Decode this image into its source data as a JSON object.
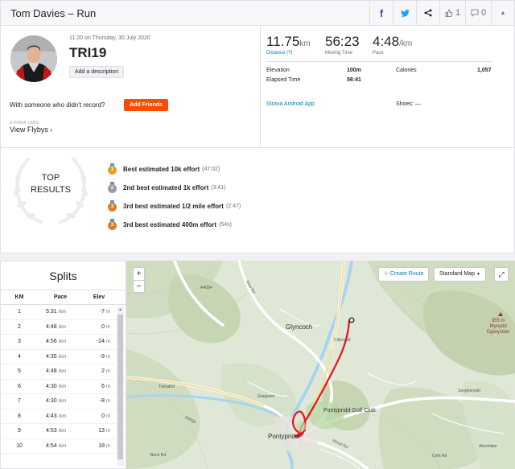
{
  "header": {
    "title": "Tom Davies – Run",
    "kudos_count": "1",
    "comment_count": "0"
  },
  "summary": {
    "datetime": "11:20 on Thursday, 30 July 2020",
    "title": "TRI19",
    "add_description": "Add a description",
    "with_someone": "With someone who didn't record?",
    "add_friends": "Add Friends",
    "labs_label": "STRAVA LABS",
    "view_flybys": "View Flybys",
    "stats": [
      {
        "value": "11.75",
        "unit": "km",
        "label": "Distance (?)"
      },
      {
        "value": "56:23",
        "unit": "",
        "label": "Moving Time"
      },
      {
        "value": "4:48",
        "unit": "/km",
        "label": "Pace"
      }
    ],
    "elevation_label": "Elevation",
    "elevation_value": "100m",
    "elapsed_label": "Elapsed Time",
    "elapsed_value": "56:41",
    "calories_label": "Calories",
    "calories_value": "1,057",
    "device": "Strava Android App",
    "shoes": "Shoes: —"
  },
  "top_results": {
    "label_line1": "TOP",
    "label_line2": "RESULTS",
    "items": [
      {
        "rank": "1",
        "text": "Best estimated 10k effort",
        "time": "(47:02)",
        "color": "#e0a030"
      },
      {
        "rank": "2",
        "text": "2nd best estimated 1k effort",
        "time": "(3:41)",
        "color": "#9a9aa0"
      },
      {
        "rank": "3",
        "text": "3rd best estimated 1/2 mile effort",
        "time": "(2:47)",
        "color": "#d8802a"
      },
      {
        "rank": "3",
        "text": "3rd best estimated 400m effort",
        "time": "(54s)",
        "color": "#d8802a"
      }
    ]
  },
  "splits": {
    "title": "Splits",
    "headers": {
      "km": "KM",
      "pace": "Pace",
      "elev": "Elev"
    },
    "pace_unit": "/km",
    "elev_unit": "m",
    "rows": [
      {
        "km": "1",
        "pace": "5:31",
        "elev": "-7"
      },
      {
        "km": "2",
        "pace": "4:48",
        "elev": "0"
      },
      {
        "km": "3",
        "pace": "4:56",
        "elev": "-24"
      },
      {
        "km": "4",
        "pace": "4:35",
        "elev": "-9"
      },
      {
        "km": "5",
        "pace": "4:48",
        "elev": "2"
      },
      {
        "km": "6",
        "pace": "4:30",
        "elev": "6"
      },
      {
        "km": "7",
        "pace": "4:30",
        "elev": "-8"
      },
      {
        "km": "8",
        "pace": "4:43",
        "elev": "0"
      },
      {
        "km": "9",
        "pace": "4:53",
        "elev": "13"
      },
      {
        "km": "10",
        "pace": "4:54",
        "elev": "18"
      }
    ]
  },
  "map": {
    "zoom_in": "+",
    "zoom_out": "−",
    "create_route": "Create Route",
    "map_type": "Standard Map",
    "places": {
      "glyncoch": "Glyncoch",
      "cilfynydd": "Cilfynydd",
      "trehafod": "Trehafod",
      "graigwen": "Graigwen",
      "golf_club": "Pontypridd Golf Club",
      "pontypridd": "Pontypridd",
      "berw_road": "Berw Rd",
      "new_rd": "New Rd",
      "a4058": "A4058",
      "a4054": "A4054",
      "wood_rd": "Wood Rd",
      "cefn": "Cefn Rd",
      "abertridwr": "Abertridwr",
      "senghenydd": "Senghenydd",
      "peak_height": "355 m",
      "peak_name1": "Mynydd",
      "peak_name2": "Eglwysilan"
    },
    "colors": {
      "route": "#e8141d",
      "river": "#a8d4f0",
      "water": "#a8d4f0",
      "terrain": "#cfdcbf"
    }
  }
}
